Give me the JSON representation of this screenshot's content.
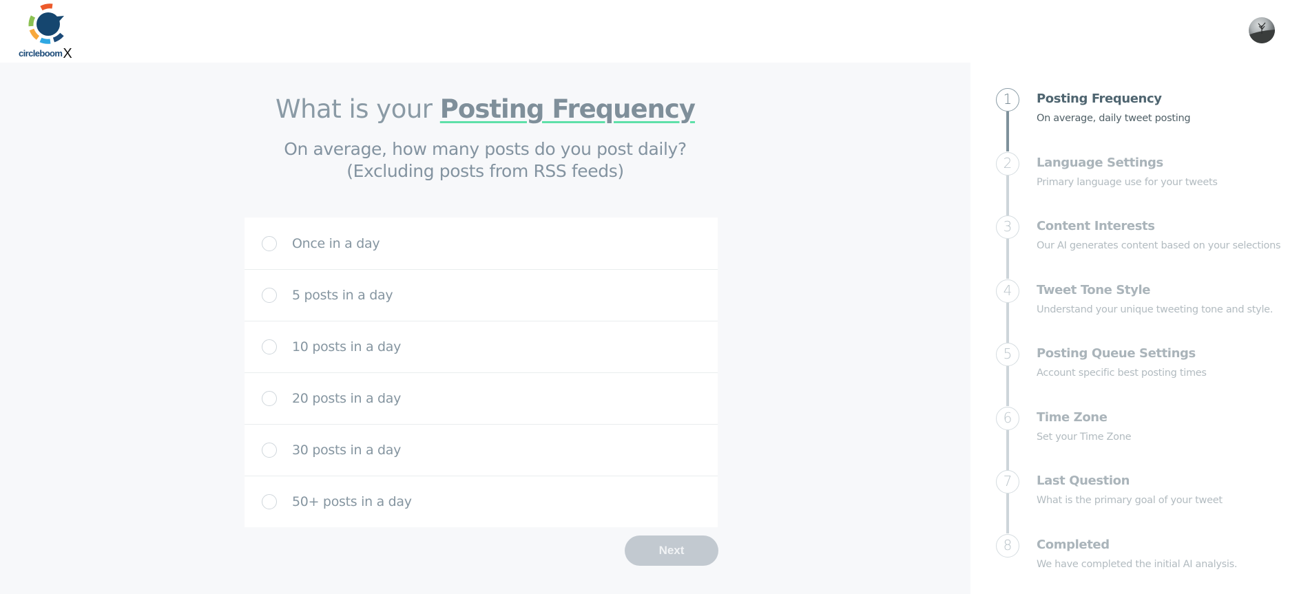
{
  "header": {
    "logo_text": "circleboom",
    "logo_suffix": "X",
    "avatar_alt": "User avatar"
  },
  "question": {
    "title_prefix": "What is your ",
    "title_highlight": "Posting Frequency",
    "subtitle_line1": "On average, how many posts do you post daily?",
    "subtitle_line2": "(Excluding posts from RSS feeds)"
  },
  "options": [
    {
      "label": "Once in a day",
      "selected": false
    },
    {
      "label": "5 posts in a day",
      "selected": false
    },
    {
      "label": "10 posts in a day",
      "selected": false
    },
    {
      "label": "20 posts in a day",
      "selected": false
    },
    {
      "label": "30 posts in a day",
      "selected": false
    },
    {
      "label": "50+ posts in a day",
      "selected": false
    }
  ],
  "actions": {
    "next_label": "Next",
    "next_enabled": false
  },
  "stepper": {
    "current_step": 1,
    "steps": [
      {
        "number": "1",
        "title": "Posting Frequency",
        "description": "On average, daily tweet posting"
      },
      {
        "number": "2",
        "title": "Language Settings",
        "description": "Primary language use for your tweets"
      },
      {
        "number": "3",
        "title": "Content Interests",
        "description": "Our AI generates content based on your selections"
      },
      {
        "number": "4",
        "title": "Tweet Tone Style",
        "description": "Understand your unique tweeting tone and style."
      },
      {
        "number": "5",
        "title": "Posting Queue Settings",
        "description": "Account specific best posting times"
      },
      {
        "number": "6",
        "title": "Time Zone",
        "description": "Set your Time Zone"
      },
      {
        "number": "7",
        "title": "Last Question",
        "description": "What is the primary goal of your tweet"
      },
      {
        "number": "8",
        "title": "Completed",
        "description": "We have completed the initial AI analysis."
      }
    ]
  },
  "colors": {
    "accent_underline": "#5ee0a8",
    "active_step": "#4f6570",
    "inactive_step": "#aab4ba",
    "button_disabled": "#c2c9d0",
    "main_bg": "#f7f8fa"
  }
}
